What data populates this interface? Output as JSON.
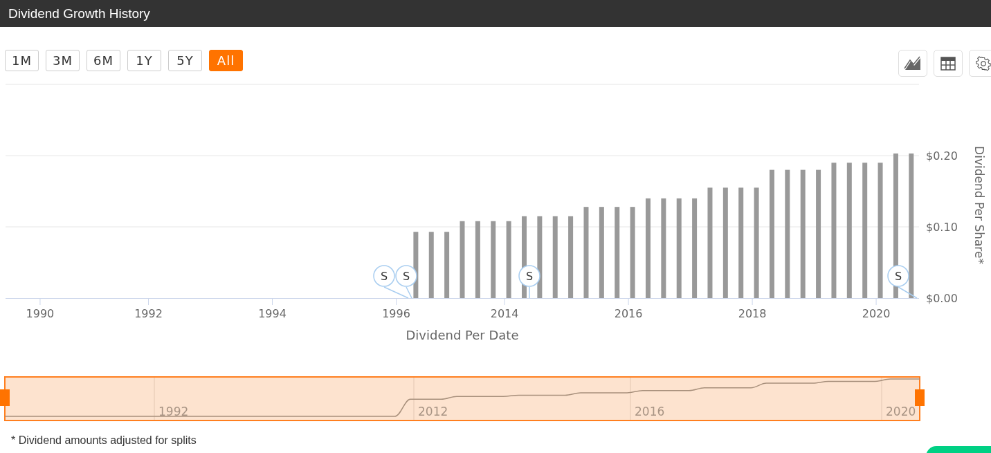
{
  "header": {
    "title": "Dividend Growth History"
  },
  "range_buttons": [
    {
      "label": "1M",
      "selected": false
    },
    {
      "label": "3M",
      "selected": false
    },
    {
      "label": "6M",
      "selected": false
    },
    {
      "label": "1Y",
      "selected": false
    },
    {
      "label": "5Y",
      "selected": false
    },
    {
      "label": "All",
      "selected": true
    }
  ],
  "tool_buttons": [
    {
      "kind": "chart"
    },
    {
      "kind": "table"
    },
    {
      "kind": "settings"
    }
  ],
  "chart": {
    "chart_data": {
      "type": "bar",
      "xlabel": "Dividend Per Date",
      "ylabel": "Dividend Per Share*",
      "categories": [
        null,
        null,
        "1990",
        null,
        null,
        null,
        null,
        null,
        null,
        "1992",
        null,
        null,
        null,
        null,
        null,
        null,
        null,
        "1994",
        null,
        null,
        null,
        null,
        null,
        null,
        null,
        "1996",
        null,
        null,
        null,
        null,
        null,
        null,
        "2014",
        null,
        null,
        null,
        null,
        null,
        null,
        null,
        "2016",
        null,
        null,
        null,
        null,
        null,
        null,
        null,
        "2018",
        null,
        null,
        null,
        null,
        null,
        null,
        null,
        "2020",
        null,
        null
      ],
      "series": [
        {
          "color": "#999999",
          "values": [
            null,
            null,
            null,
            null,
            null,
            null,
            null,
            null,
            null,
            null,
            null,
            null,
            null,
            null,
            null,
            null,
            null,
            null,
            null,
            null,
            null,
            null,
            null,
            null,
            null,
            null,
            0.093,
            0.093,
            0.093,
            0.108,
            0.108,
            0.108,
            0.108,
            0.115,
            0.115,
            0.115,
            0.115,
            0.128,
            0.128,
            0.128,
            0.128,
            0.14,
            0.14,
            0.14,
            0.14,
            0.155,
            0.155,
            0.155,
            0.155,
            0.18,
            0.18,
            0.18,
            0.18,
            0.19,
            0.19,
            0.19,
            0.19,
            0.203,
            0.203
          ]
        }
      ],
      "ylim": [
        0,
        0.3
      ],
      "yticks": [
        {
          "value": 0,
          "label": "$0.00"
        },
        {
          "value": 0.1,
          "label": "$0.10"
        },
        {
          "value": 0.2,
          "label": "$0.20"
        }
      ],
      "annotations": [
        "S",
        "S",
        "S",
        "S"
      ]
    }
  },
  "navigator": {
    "labels": [
      "1992",
      "2012",
      "2016",
      "2020"
    ]
  },
  "footnote": "* Dividend amounts adjusted for splits"
}
